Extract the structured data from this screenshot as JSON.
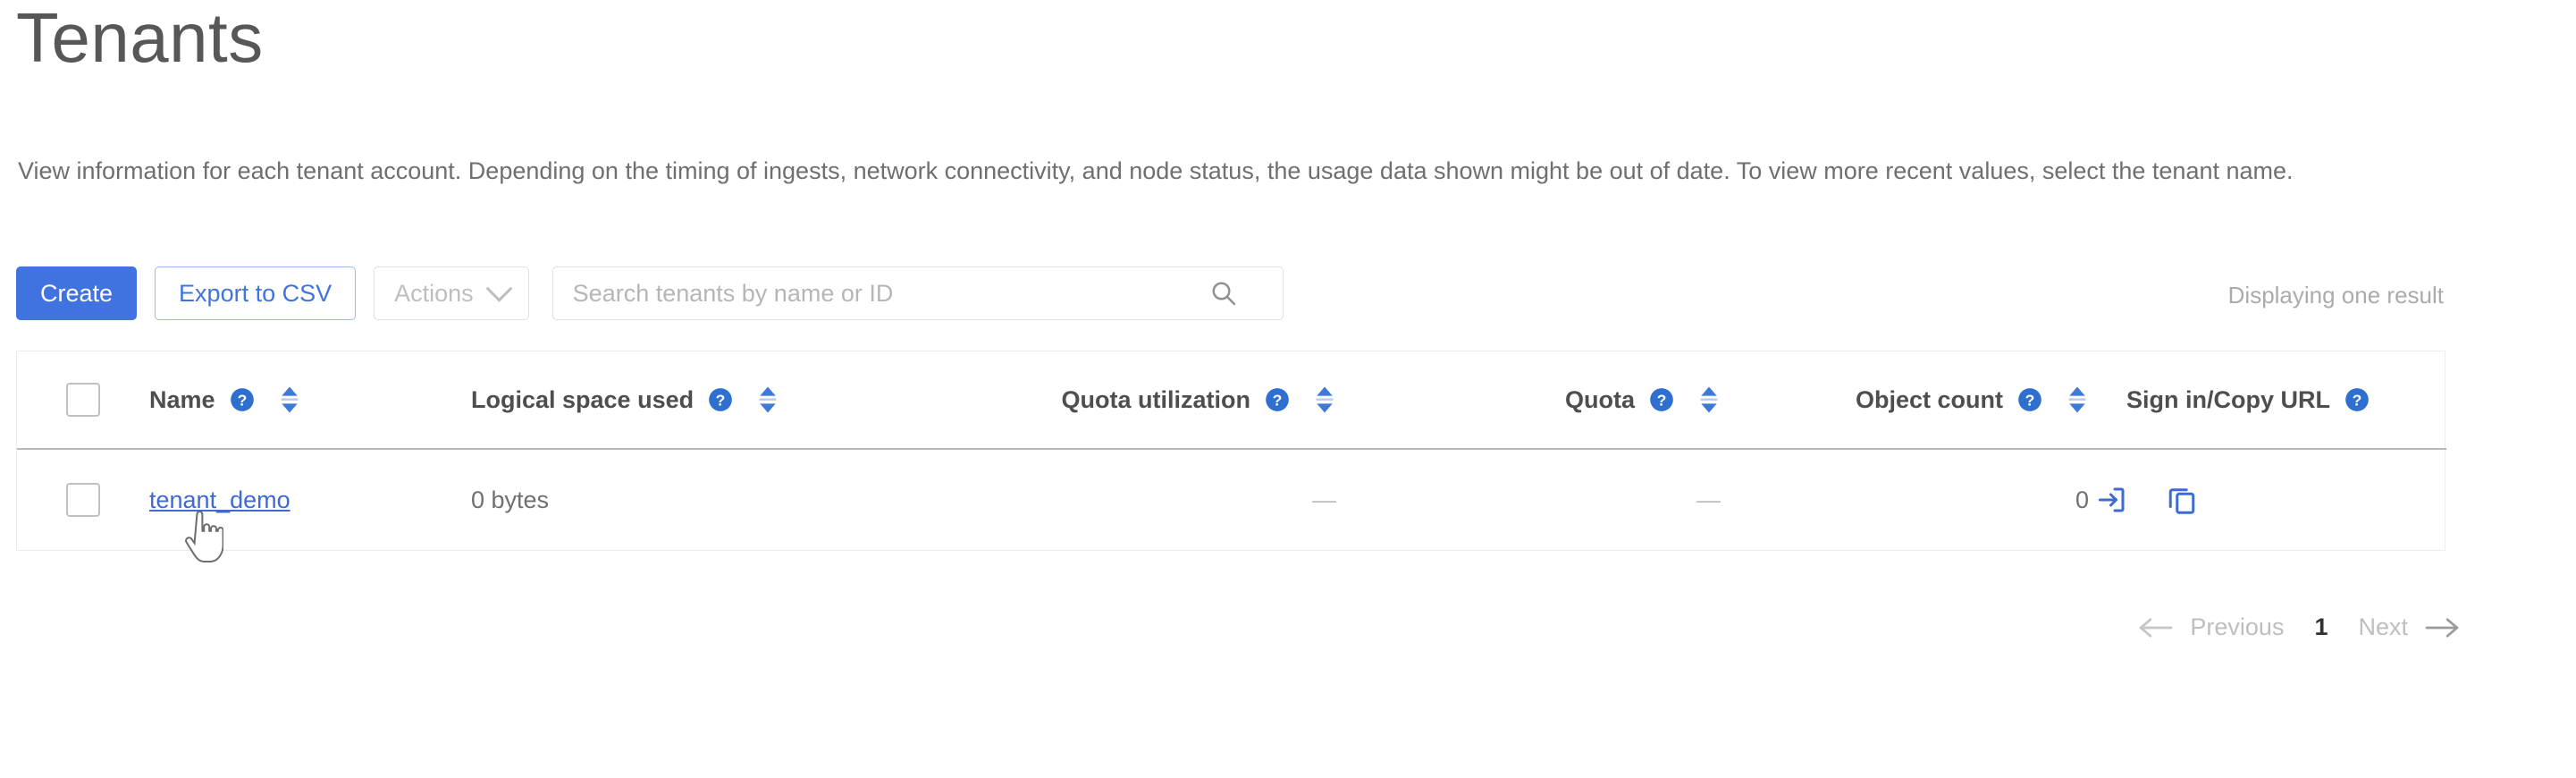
{
  "page": {
    "title": "Tenants",
    "description": "View information for each tenant account. Depending on the timing of ingests, network connectivity, and node status, the usage data shown might be out of date. To view more recent values, select the tenant name."
  },
  "toolbar": {
    "create_label": "Create",
    "export_label": "Export to CSV",
    "actions_label": "Actions",
    "actions_chevron_icon": "chevron-down-icon",
    "search_value": "",
    "search_placeholder": "Search tenants by name or ID",
    "search_icon": "search-icon",
    "result_count": "Displaying one result"
  },
  "table": {
    "select_all_checkbox": "",
    "columns": [
      {
        "label": "Name",
        "help_icon": "help-circle-icon",
        "sortable": true,
        "align": "left"
      },
      {
        "label": "Logical space used",
        "help_icon": "help-circle-icon",
        "sortable": true,
        "align": "left"
      },
      {
        "label": "Quota utilization",
        "help_icon": "help-circle-icon",
        "sortable": true,
        "align": "right"
      },
      {
        "label": "Quota",
        "help_icon": "help-circle-icon",
        "sortable": true,
        "align": "right"
      },
      {
        "label": "Object count",
        "help_icon": "help-circle-icon",
        "sortable": true,
        "align": "right"
      },
      {
        "label": "Sign in/Copy URL",
        "help_icon": "help-circle-icon",
        "sortable": false,
        "align": "right"
      }
    ],
    "rows": [
      {
        "name": "tenant_demo",
        "logical_space_used": "0 bytes",
        "quota_utilization": "—",
        "quota": "—",
        "object_count": "0",
        "sign_in_icon": "sign-in-icon",
        "copy_url_icon": "copy-icon"
      }
    ]
  },
  "pagination": {
    "previous_label": "Previous",
    "previous_icon": "arrow-left-icon",
    "current_page": "1",
    "next_label": "Next",
    "next_icon": "arrow-right-icon"
  },
  "colors": {
    "primary_blue": "#4073e0",
    "link_blue": "#3f6ad4",
    "icon_blue": "#2f6fd0",
    "muted_gray": "#bcbec1",
    "text_gray": "#6d6f72",
    "title_gray": "#555759",
    "border_light": "#eceded",
    "header_rule": "#b6b8ba"
  }
}
